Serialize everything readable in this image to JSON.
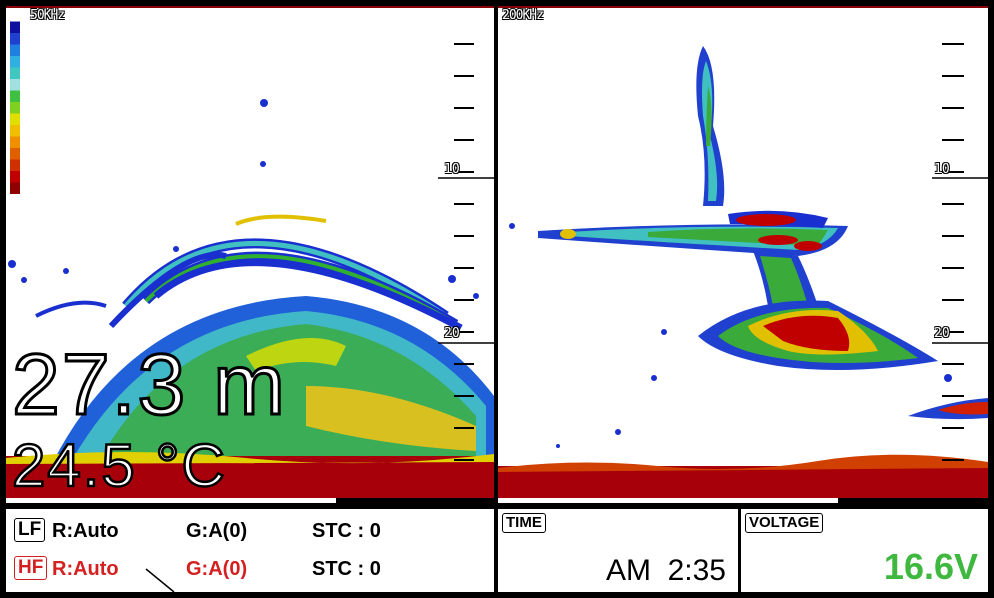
{
  "left_panel": {
    "frequency": "50KHz",
    "scale_labels": [
      "10",
      "20"
    ],
    "depth": "27.3 m",
    "temperature": "24.5 °C"
  },
  "right_panel": {
    "frequency": "200KHz",
    "scale_labels": [
      "10",
      "20"
    ]
  },
  "status": {
    "lf": {
      "tag": "LF",
      "range": "R:Auto",
      "gain": "G:A(0)",
      "stc": "STC : 0"
    },
    "hf": {
      "tag": "HF",
      "range": "R:Auto",
      "gain": "G:A(0)",
      "stc": "STC : 0"
    }
  },
  "time": {
    "label": "TIME",
    "value": "AM  2:35"
  },
  "voltage": {
    "label": "VOLTAGE",
    "value": "16.6V"
  },
  "colors": {
    "bottom_red": "#a8000b",
    "accent_red": "#d42020",
    "voltage_green": "#3fb83f",
    "color_bar": [
      "#ffffff",
      "#1010a0",
      "#2040d0",
      "#2080e0",
      "#30b0e0",
      "#40c8c0",
      "#a0e0e0",
      "#40c040",
      "#80d020",
      "#e0e000",
      "#f0c000",
      "#f09000",
      "#e06000",
      "#d03000",
      "#c00000",
      "#900000"
    ]
  }
}
